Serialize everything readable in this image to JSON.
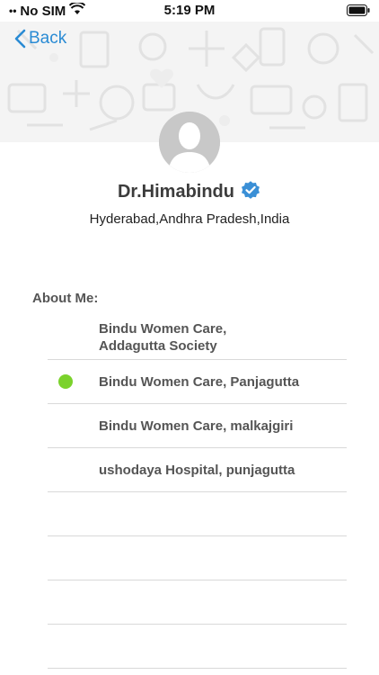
{
  "status_bar": {
    "carrier": "No SIM",
    "time": "5:19 PM"
  },
  "nav": {
    "back_label": "Back",
    "accent_color": "#2a8bd4"
  },
  "profile": {
    "name": "Dr.Himabindu",
    "verified": true,
    "location": "Hyderabad,Andhra Pradesh,India"
  },
  "about": {
    "label": "About Me:"
  },
  "hospitals": [
    {
      "name": "Bindu Women Care, Addagutta Society",
      "line1": "Bindu Women Care,",
      "line2": "Addagutta Society",
      "active": false
    },
    {
      "name": "Bindu Women Care, Panjagutta",
      "active": true
    },
    {
      "name": "Bindu Women Care, malkajgiri",
      "active": false
    },
    {
      "name": "ushodaya Hospital, punjagutta",
      "active": false
    }
  ],
  "active_color": "#7bd22c"
}
